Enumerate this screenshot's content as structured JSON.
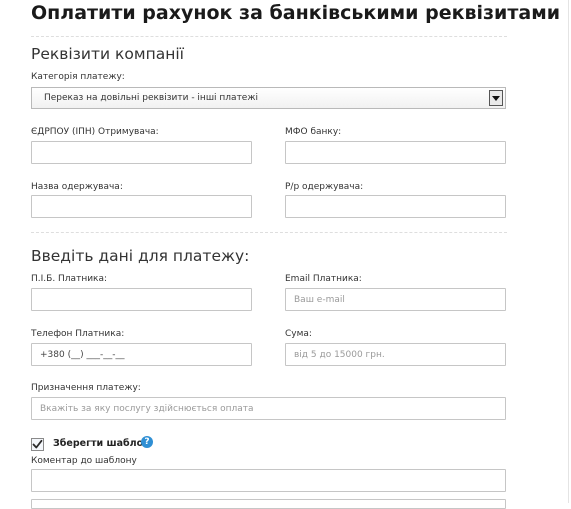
{
  "title": "Оплатити рахунок за банківськими реквізитами",
  "company_section": {
    "heading": "Реквізити компанії",
    "category_label": "Категорія платежу:",
    "category_value": "Переказ на довільні реквізити - інші платежі",
    "edrpou_label": "ЄДРПОУ (ІПН) Отримувача:",
    "edrpou_value": "",
    "mfo_label": "МФО банку:",
    "mfo_value": "",
    "recipient_name_label": "Назва одержувача:",
    "recipient_name_value": "",
    "account_label": "Р/р одержувача:",
    "account_value": ""
  },
  "payment_section": {
    "heading": "Введіть дані для платежу:",
    "payer_name_label": "П.І.Б. Платника:",
    "payer_name_value": "",
    "email_label": "Email Платника:",
    "email_placeholder": "Ваш e-mail",
    "phone_label": "Телефон Платника:",
    "phone_value": "+380 (__) ___-__-__",
    "amount_label": "Сума:",
    "amount_placeholder": "від 5 до 15000 грн.",
    "purpose_label": "Призначення платежу:",
    "purpose_placeholder": "Вкажіть за яку послугу здійснюється оплата"
  },
  "template": {
    "save_label": "Зберегти шаблон",
    "save_checked": true,
    "help_glyph": "?",
    "comment_label": "Коментар до шаблону",
    "comment_value": ""
  },
  "colors": {
    "help_badge": "#2f8fd4",
    "checkmark": "#2b2b2b"
  }
}
